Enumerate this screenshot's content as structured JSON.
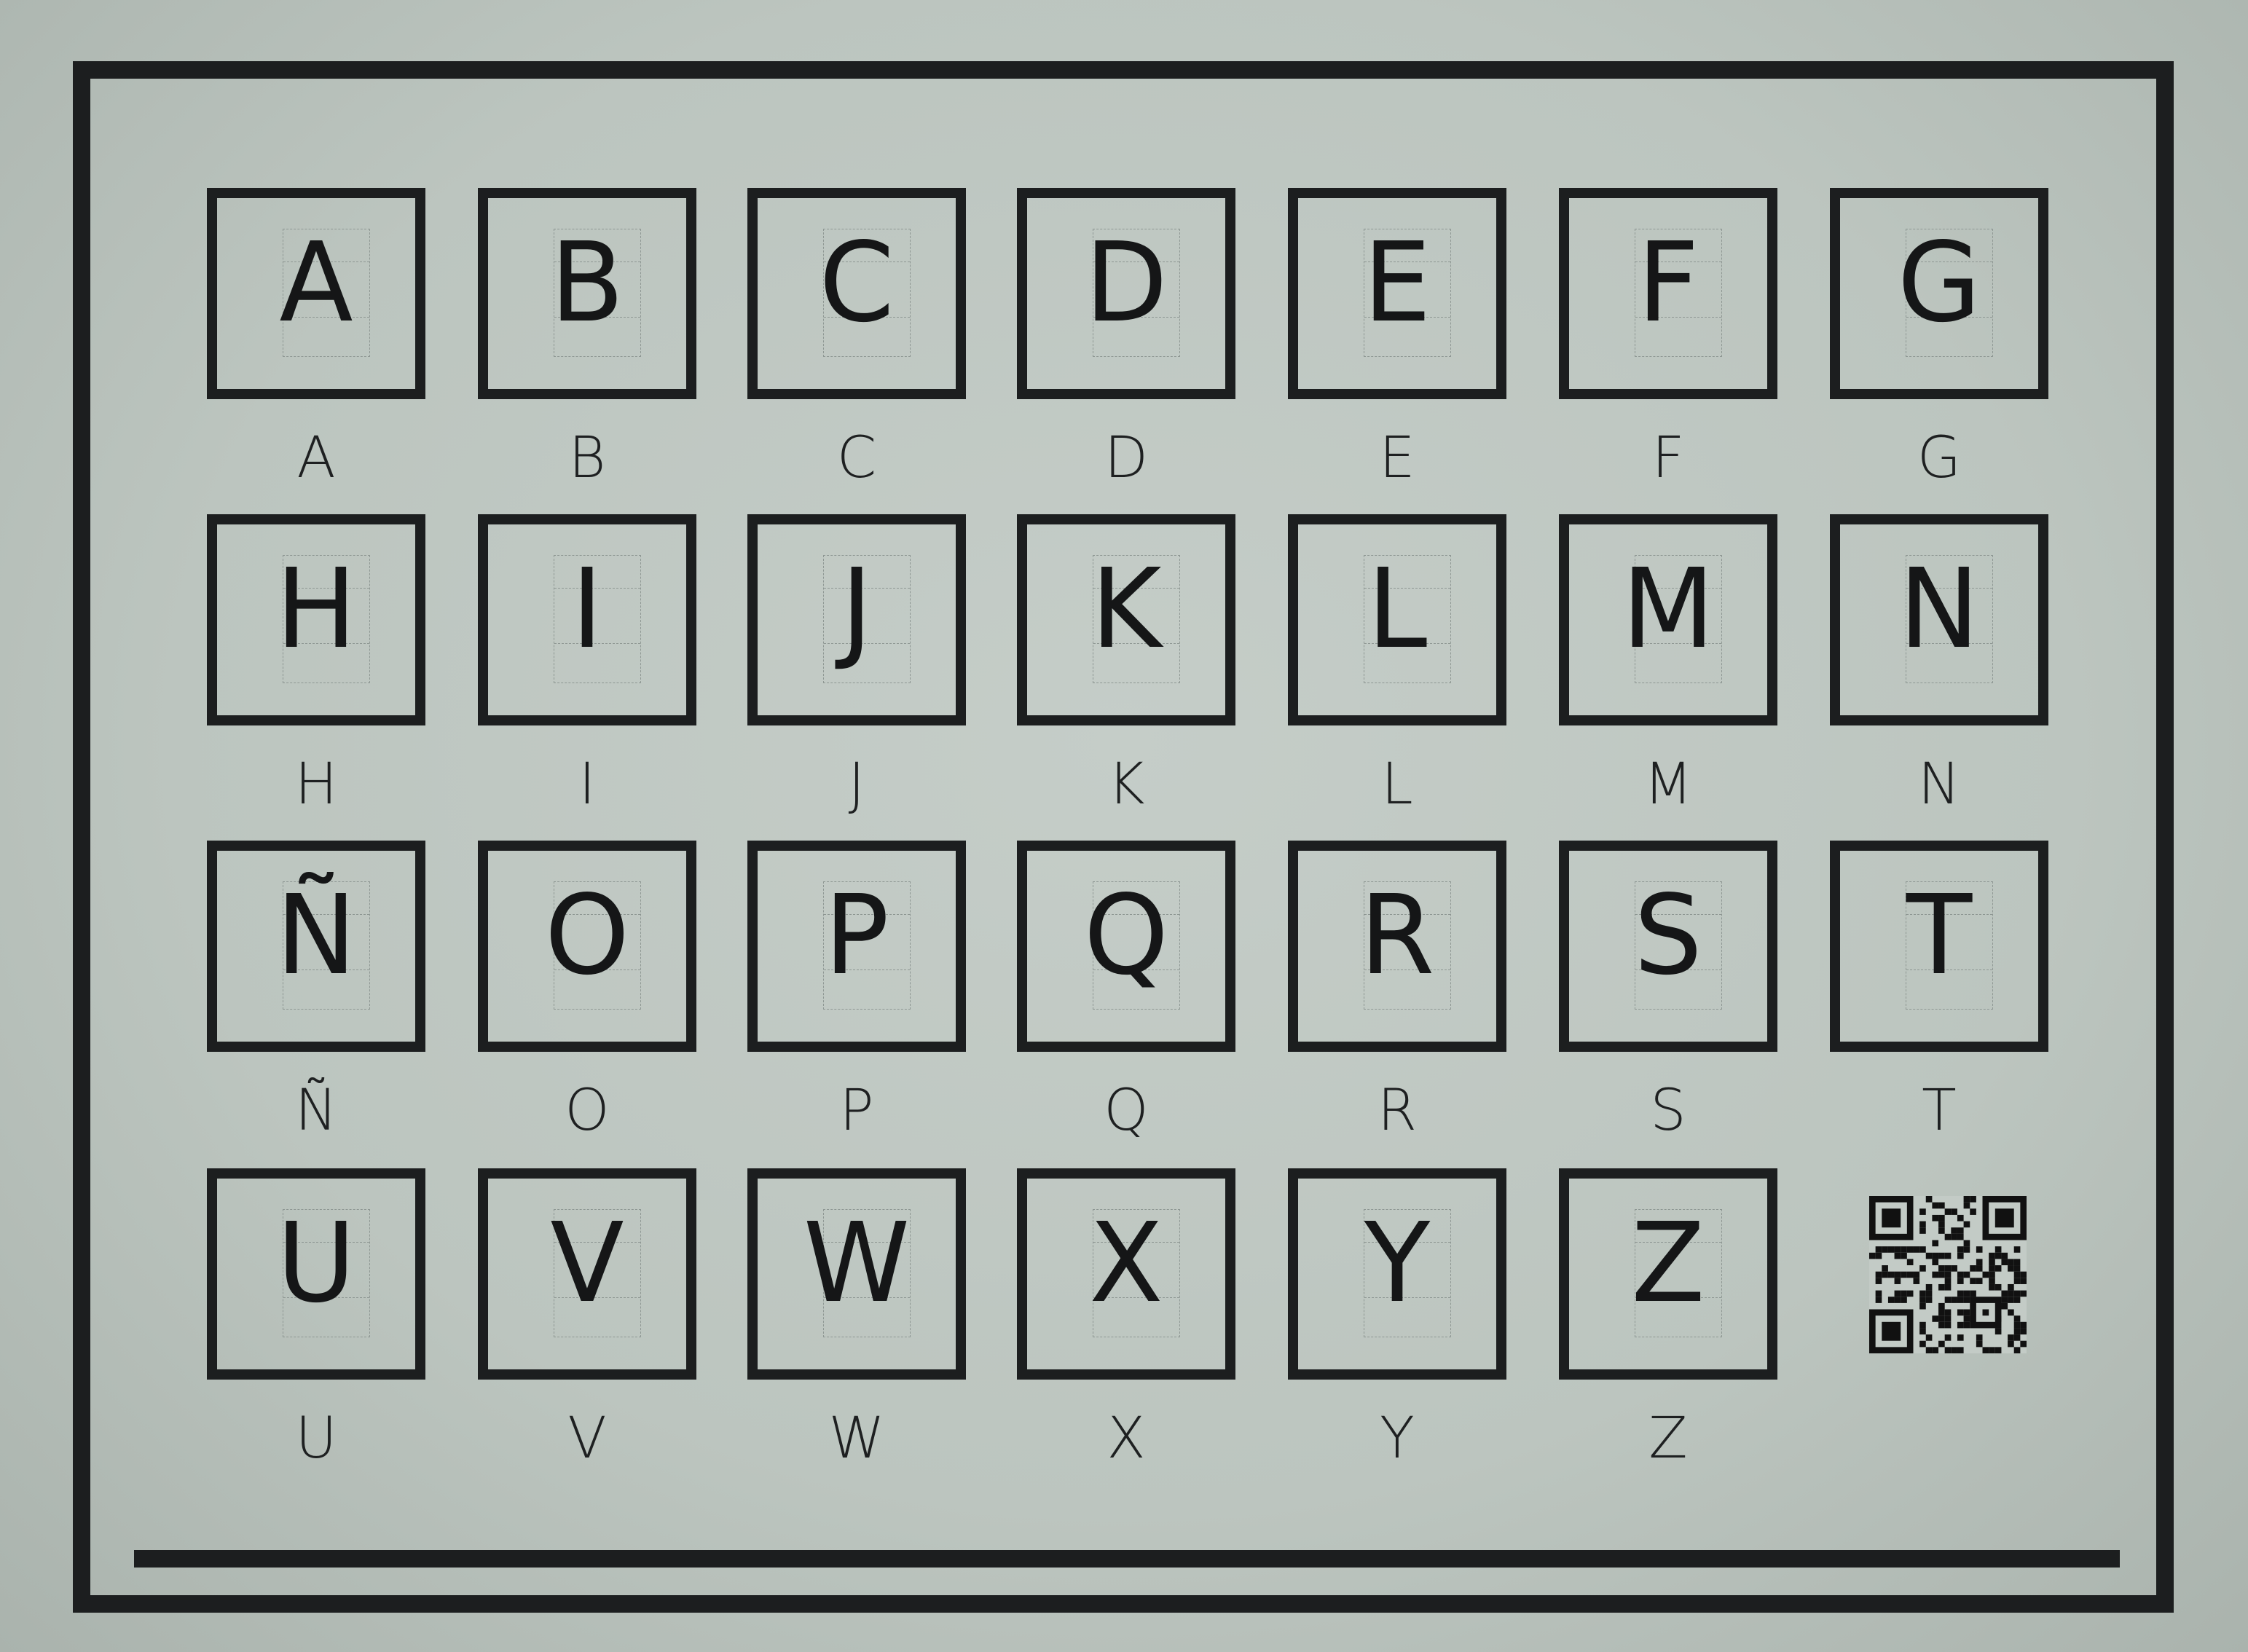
{
  "worksheet": {
    "rows": [
      [
        "A",
        "B",
        "C",
        "D",
        "E",
        "F",
        "G"
      ],
      [
        "H",
        "I",
        "J",
        "K",
        "L",
        "M",
        "N"
      ],
      [
        "Ñ",
        "O",
        "P",
        "Q",
        "R",
        "S",
        "T"
      ],
      [
        "U",
        "V",
        "W",
        "X",
        "Y",
        "Z"
      ]
    ],
    "qr_code": "qr-code"
  }
}
